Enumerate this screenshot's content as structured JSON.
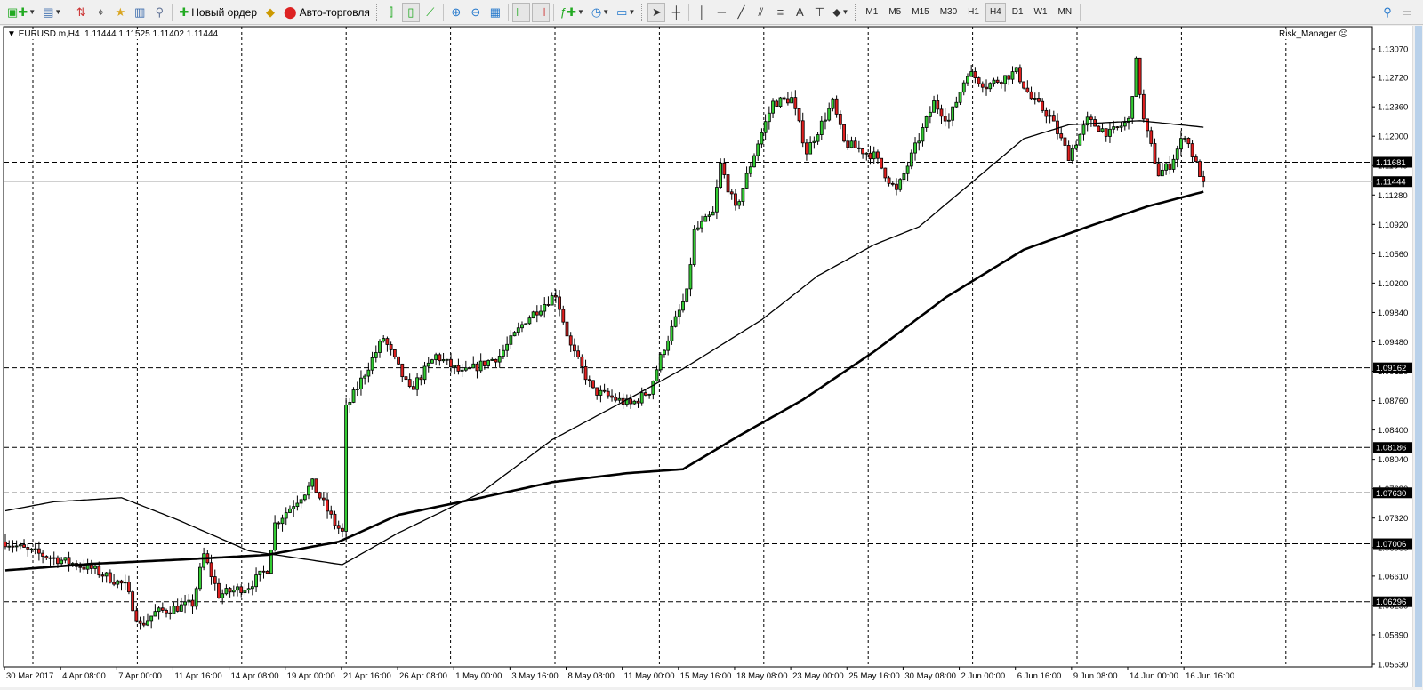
{
  "toolbar": {
    "new_order_label": "Новый ордер",
    "auto_trading_label": "Авто-торговля",
    "timeframes": [
      "M1",
      "M5",
      "M15",
      "M30",
      "H1",
      "H4",
      "D1",
      "W1",
      "MN"
    ],
    "active_timeframe": "H4"
  },
  "chart": {
    "symbol_header": "EURUSD.m,H4",
    "ohlc": "1.11444 1.11525 1.11402 1.11444",
    "indicator_label": "Risk_Manager",
    "price_ticks": [
      "1.13070",
      "1.12720",
      "1.12360",
      "1.12000",
      "1.11640",
      "1.11280",
      "1.10920",
      "1.10560",
      "1.10200",
      "1.09840",
      "1.09480",
      "1.09120",
      "1.08760",
      "1.08400",
      "1.08040",
      "1.07680",
      "1.07320",
      "1.06960",
      "1.06610",
      "1.06250",
      "1.05890",
      "1.05530"
    ],
    "price_range": [
      1.0553,
      1.1307
    ],
    "levels": [
      "1.11681",
      "1.09162",
      "1.08186",
      "1.07630",
      "1.07006",
      "1.06296"
    ],
    "bid": "1.11444",
    "time_labels": [
      "30 Mar 2017",
      "4 Apr 08:00",
      "7 Apr 00:00",
      "11 Apr 16:00",
      "14 Apr 08:00",
      "19 Apr 00:00",
      "21 Apr 16:00",
      "26 Apr 08:00",
      "1 May 00:00",
      "3 May 16:00",
      "8 May 08:00",
      "11 May 00:00",
      "15 May 16:00",
      "18 May 08:00",
      "23 May 00:00",
      "25 May 16:00",
      "30 May 08:00",
      "2 Jun 00:00",
      "6 Jun 16:00",
      "9 Jun 08:00",
      "14 Jun 00:00",
      "16 Jun 16:00"
    ],
    "bars": 320,
    "colors": {
      "bull": "#33cc33",
      "bear": "#e02020",
      "outline": "#000000",
      "grid": "#000000",
      "bid": "#c0c0c0"
    },
    "price_path": [
      [
        0,
        1.0703
      ],
      [
        6,
        1.0692
      ],
      [
        23,
        1.067
      ],
      [
        32,
        1.0649
      ],
      [
        36,
        1.06
      ],
      [
        40,
        1.0616
      ],
      [
        50,
        1.0627
      ],
      [
        53,
        1.0687
      ],
      [
        57,
        1.0638
      ],
      [
        65,
        1.0649
      ],
      [
        70,
        1.067
      ],
      [
        72,
        1.0725
      ],
      [
        82,
        1.0774
      ],
      [
        88,
        1.0725
      ],
      [
        90,
        1.0714
      ],
      [
        91,
        1.0866
      ],
      [
        101,
        1.0953
      ],
      [
        108,
        1.0888
      ],
      [
        115,
        1.0931
      ],
      [
        122,
        1.0909
      ],
      [
        132,
        1.0931
      ],
      [
        139,
        1.0975
      ],
      [
        147,
        1.1007
      ],
      [
        151,
        1.0942
      ],
      [
        157,
        1.0888
      ],
      [
        167,
        1.0871
      ],
      [
        172,
        1.0888
      ],
      [
        176,
        1.0942
      ],
      [
        182,
        1.1007
      ],
      [
        184,
        1.1083
      ],
      [
        189,
        1.1105
      ],
      [
        191,
        1.1165
      ],
      [
        195,
        1.111
      ],
      [
        201,
        1.1192
      ],
      [
        205,
        1.1241
      ],
      [
        210,
        1.1246
      ],
      [
        214,
        1.1181
      ],
      [
        221,
        1.1241
      ],
      [
        224,
        1.1192
      ],
      [
        232,
        1.1176
      ],
      [
        238,
        1.1132
      ],
      [
        243,
        1.1186
      ],
      [
        248,
        1.1241
      ],
      [
        252,
        1.1219
      ],
      [
        257,
        1.1279
      ],
      [
        262,
        1.1262
      ],
      [
        270,
        1.1279
      ],
      [
        274,
        1.1246
      ],
      [
        279,
        1.1224
      ],
      [
        284,
        1.1176
      ],
      [
        289,
        1.1219
      ],
      [
        295,
        1.1203
      ],
      [
        300,
        1.1219
      ],
      [
        302,
        1.129
      ],
      [
        304,
        1.1219
      ],
      [
        308,
        1.1154
      ],
      [
        311,
        1.1165
      ],
      [
        315,
        1.1203
      ],
      [
        318,
        1.1165
      ],
      [
        320,
        1.1144
      ]
    ],
    "ma_fast": [
      [
        0,
        1.0741
      ],
      [
        13,
        1.0752
      ],
      [
        31,
        1.0757
      ],
      [
        46,
        1.073
      ],
      [
        65,
        1.0692
      ],
      [
        90,
        1.0675
      ],
      [
        105,
        1.0714
      ],
      [
        127,
        1.0763
      ],
      [
        146,
        1.0828
      ],
      [
        166,
        1.0877
      ],
      [
        181,
        1.0915
      ],
      [
        202,
        1.0975
      ],
      [
        217,
        1.1029
      ],
      [
        232,
        1.1067
      ],
      [
        244,
        1.1089
      ],
      [
        258,
        1.1143
      ],
      [
        272,
        1.1197
      ],
      [
        284,
        1.1214
      ],
      [
        303,
        1.1219
      ],
      [
        320,
        1.1211
      ]
    ],
    "ma_slow": [
      [
        0,
        1.0668
      ],
      [
        23,
        1.0676
      ],
      [
        46,
        1.0681
      ],
      [
        70,
        1.0687
      ],
      [
        89,
        1.0703
      ],
      [
        105,
        1.0736
      ],
      [
        127,
        1.0757
      ],
      [
        146,
        1.0776
      ],
      [
        166,
        1.0787
      ],
      [
        181,
        1.0792
      ],
      [
        196,
        1.0833
      ],
      [
        213,
        1.0877
      ],
      [
        232,
        1.0936
      ],
      [
        251,
        1.1002
      ],
      [
        272,
        1.1061
      ],
      [
        289,
        1.1089
      ],
      [
        305,
        1.1114
      ],
      [
        320,
        1.1132
      ]
    ]
  }
}
